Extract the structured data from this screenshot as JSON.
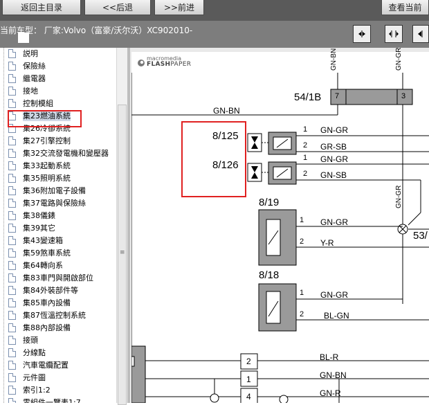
{
  "toolbar": {
    "btn_home": "返回主目录",
    "btn_back": "<<后退",
    "btn_forward": ">>前进",
    "btn_view": "查看当前"
  },
  "info": {
    "model_text": "当前车型：  厂家:Volvo（富豪/沃尔沃）XC902010-"
  },
  "tree": {
    "items": [
      {
        "label": "説明"
      },
      {
        "label": "保險絲"
      },
      {
        "label": "繼電器"
      },
      {
        "label": "接地"
      },
      {
        "label": "控制模組"
      },
      {
        "label": "集23燃油系統",
        "selected": true
      },
      {
        "label": "集26冷卻系統"
      },
      {
        "label": "集27引擎控制"
      },
      {
        "label": "集32交流發電機和變壓器"
      },
      {
        "label": "集33起動系統"
      },
      {
        "label": "集35照明系統"
      },
      {
        "label": "集36附加電子設備"
      },
      {
        "label": "集37電路與保險絲"
      },
      {
        "label": "集38儀錶"
      },
      {
        "label": "集39其它"
      },
      {
        "label": "集43變速箱"
      },
      {
        "label": "集59煞車系統"
      },
      {
        "label": "集64轉向系"
      },
      {
        "label": "集83車門與開啟部位"
      },
      {
        "label": "集84外裝部件等"
      },
      {
        "label": "集85車內設備"
      },
      {
        "label": "集87恆溫控制系統"
      },
      {
        "label": "集88內部設備"
      },
      {
        "label": "接頭"
      },
      {
        "label": "分線點"
      },
      {
        "label": "汽車電纜配置"
      },
      {
        "label": "元件圖"
      },
      {
        "label": "索引1:2"
      },
      {
        "label": "零組件一覽表1:7"
      }
    ]
  },
  "viewer": {
    "logo_small": "macromedia",
    "logo_big_a": "FLASH",
    "logo_big_b": "PAPER"
  },
  "diagram": {
    "top_wire_1": "GN-BN",
    "top_wire_2": "GN-GR",
    "connector_54": "54/1B",
    "pin_7": "7",
    "pin_3": "3",
    "wire_gnbn_left": "GN-BN",
    "c125": "8/125",
    "c126": "8/126",
    "c125_p1": "1",
    "c125_w1": "GN-GR",
    "c125_p2": "2",
    "c125_w2": "GR-SB",
    "c126_p1": "1",
    "c126_w1": "GN-GR",
    "c126_p2": "2",
    "c126_w2": "GN-SB",
    "vertical_wire": "GN-GR",
    "c819": "8/19",
    "c819_p1": "1",
    "c819_w1": "GN-GR",
    "c819_p2": "2",
    "c819_w2": "Y-R",
    "splice": "53/",
    "c818": "8/18",
    "c818_p1": "1",
    "c818_w1": "GN-GR",
    "c818_p2": "2",
    "c818_w2": "BL-GN",
    "bottom_p2": "2",
    "bottom_w2": "BL-R",
    "bottom_p1": "1",
    "bottom_w1": "GN-BN",
    "bottom_p4": "4",
    "bottom_w4": "GN-R"
  }
}
